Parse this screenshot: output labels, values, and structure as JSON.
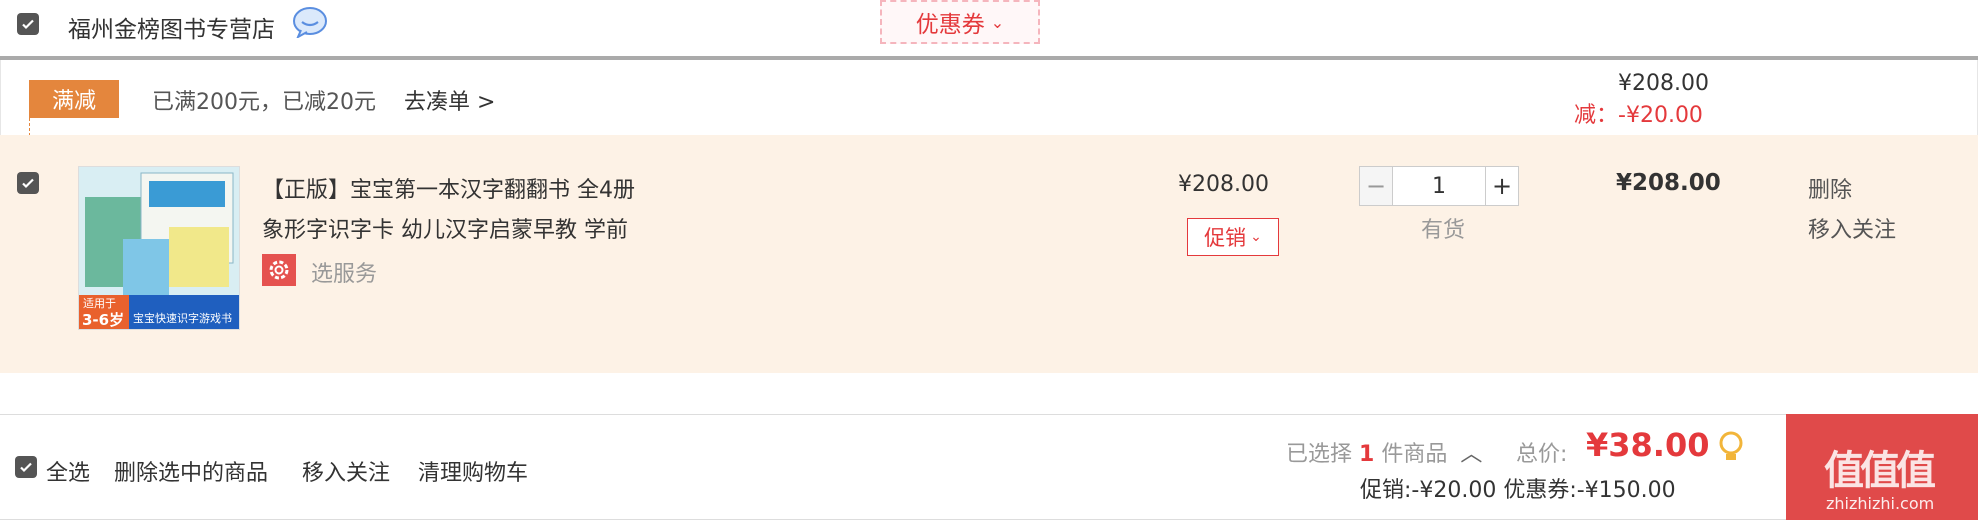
{
  "shop": {
    "name": "福州金榜图书专营店",
    "checkbox_checked": true
  },
  "coupon_button": {
    "label": "优惠券"
  },
  "promo": {
    "tag": "满减",
    "text": "已满200元，已减20元",
    "link": "去凑单 >",
    "subtotal": "¥208.00",
    "discount_label": "减：",
    "discount_value": "-¥20.00"
  },
  "item": {
    "checkbox_checked": true,
    "title_line1": "【正版】宝宝第一本汉字翻翻书 全4册",
    "title_line2": "象形字识字卡 幼儿汉字启蒙早教 学前",
    "service_label": "选服务",
    "price": "¥208.00",
    "promo_button": "促销",
    "qty_minus": "−",
    "qty_value": "1",
    "qty_plus": "+",
    "stock": "有货",
    "subtotal": "¥208.00",
    "delete": "删除",
    "move_follow": "移入关注",
    "thumb_age_tag": "适用于",
    "thumb_age": "3-6岁",
    "thumb_banner": "宝宝快速识字游戏书"
  },
  "footer": {
    "select_all": "全选",
    "delete_selected": "删除选中的商品",
    "move_follow": "移入关注",
    "clear_cart": "清理购物车",
    "selected_prefix": "已选择",
    "selected_count": "1",
    "selected_suffix": "件商品",
    "total_label": "总价:",
    "total_value": "¥38.00",
    "promo_line": "促销:-¥20.00 优惠券:-¥150.00",
    "checkout_watermark": "值值值",
    "watermark_url": "zhizhizhi.com"
  },
  "colors": {
    "accent": "#e4393c",
    "promo_tag": "#e4863d",
    "item_bg": "#fdf2e6",
    "checkout_bg": "#e04a4a"
  }
}
